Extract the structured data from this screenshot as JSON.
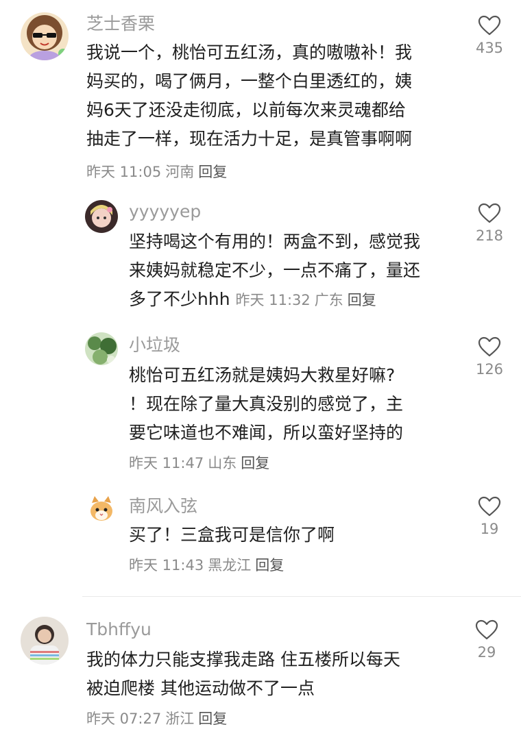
{
  "comments": [
    {
      "name": "芝士香栗",
      "lines": [
        "我说一个，桃怡可五红汤，真的嗷嗷补！我",
        "妈买的，喝了俩月，一整个白里透红的，姨",
        "妈6天了还没走彻底，以前每次来灵魂都给",
        "抽走了一样，现在活力十足，是真管事啊啊"
      ],
      "time": "昨天 11:05",
      "location": "河南",
      "reply": "回复",
      "likes": "435",
      "avatar_icon": "cartoon-sunglasses-avatar"
    },
    {
      "name": "yyyyyep",
      "lines": [
        "坚持喝这个有用的！两盒不到，感觉我",
        "来姨妈就稳定不少，一点不痛了，量还",
        "多了不少hhh"
      ],
      "time": "昨天 11:32",
      "location": "广东",
      "reply": "回复",
      "likes": "218",
      "avatar_icon": "anime-girl-avatar"
    },
    {
      "name": "小垃圾",
      "lines": [
        "桃怡可五红汤就是姨妈大救星好嘛?",
        "！现在除了量大真没别的感觉了，主",
        "要它味道也不难闻，所以蛮好坚持的"
      ],
      "time": "昨天 11:47",
      "location": "山东",
      "reply": "回复",
      "likes": "126",
      "avatar_icon": "green-leaves-avatar"
    },
    {
      "name": "南风入弦",
      "lines": [
        "买了！三盒我可是信你了啊"
      ],
      "time": "昨天 11:43",
      "location": "黑龙江",
      "reply": "回复",
      "likes": "19",
      "avatar_icon": "kitten-avatar"
    },
    {
      "name": "Tbhffyu",
      "lines": [
        "我的体力只能支撑我走路 住五楼所以每天",
        "被迫爬楼 其他运动做不了一点"
      ],
      "time": "昨天 07:27",
      "location": "浙江",
      "reply": "回复",
      "likes": "29",
      "avatar_icon": "girl-photo-avatar"
    }
  ],
  "colors": {
    "name": "#9a9a9a",
    "text": "#1f1f1f",
    "meta": "#8a8a8a",
    "divider": "#e9e9e9"
  }
}
